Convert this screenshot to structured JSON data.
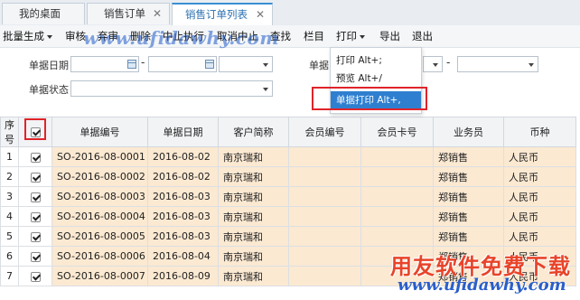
{
  "tabs": [
    {
      "label": "我的桌面"
    },
    {
      "label": "销售订单"
    },
    {
      "label": "销售订单列表"
    }
  ],
  "toolbar": {
    "batch_generate": "批量生成",
    "audit": "审核",
    "abandon": "弃审",
    "delete": "删除",
    "stop_exec": "中止执行",
    "cancel_stop": "取消中止",
    "find": "查找",
    "columns": "栏目",
    "print": "打印",
    "export": "导出",
    "exit": "退出"
  },
  "watermark": "www.ufidawhy.com",
  "filters": {
    "doc_date_label": "单据日期",
    "doc_label_2": "单据",
    "doc_status_label": "单据状态",
    "dash": "-"
  },
  "print_menu": {
    "items": [
      {
        "label": "打印  Alt+;"
      },
      {
        "label": "预览  Alt+/"
      },
      {
        "label": "单据打印  Alt+,"
      }
    ]
  },
  "table": {
    "headers": [
      "序号",
      "",
      "单据编号",
      "单据日期",
      "客户简称",
      "会员编号",
      "会员卡号",
      "业务员",
      "币种"
    ],
    "rows": [
      {
        "no": "1",
        "code": "SO-2016-08-0001",
        "date": "2016-08-02",
        "customer": "南京瑞和",
        "member_no": "",
        "card_no": "",
        "salesman": "郑销售",
        "currency": "人民币"
      },
      {
        "no": "2",
        "code": "SO-2016-08-0002",
        "date": "2016-08-02",
        "customer": "南京瑞和",
        "member_no": "",
        "card_no": "",
        "salesman": "郑销售",
        "currency": "人民币"
      },
      {
        "no": "3",
        "code": "SO-2016-08-0003",
        "date": "2016-08-03",
        "customer": "南京瑞和",
        "member_no": "",
        "card_no": "",
        "salesman": "郑销售",
        "currency": "人民币"
      },
      {
        "no": "4",
        "code": "SO-2016-08-0004",
        "date": "2016-08-03",
        "customer": "南京瑞和",
        "member_no": "",
        "card_no": "",
        "salesman": "郑销售",
        "currency": "人民币"
      },
      {
        "no": "5",
        "code": "SO-2016-08-0005",
        "date": "2016-08-03",
        "customer": "南京瑞和",
        "member_no": "",
        "card_no": "",
        "salesman": "郑销售",
        "currency": "人民币"
      },
      {
        "no": "6",
        "code": "SO-2016-08-0006",
        "date": "2016-08-04",
        "customer": "南京瑞和",
        "member_no": "",
        "card_no": "",
        "salesman": "郑销售",
        "currency": "人民币"
      },
      {
        "no": "7",
        "code": "SO-2016-08-0007",
        "date": "2016-08-09",
        "customer": "南京瑞和",
        "member_no": "",
        "card_no": "",
        "salesman": "郑销售",
        "currency": "人民币"
      }
    ]
  },
  "brand": {
    "name": "用友软件免费下载",
    "url": "www.ufidawhy.com"
  },
  "colors": {
    "active_tab_accent": "#3a8fd3",
    "menu_highlight": "#2f7fd0",
    "row_highlight": "#fbe9d2",
    "annotation_red": "#e0242a"
  }
}
